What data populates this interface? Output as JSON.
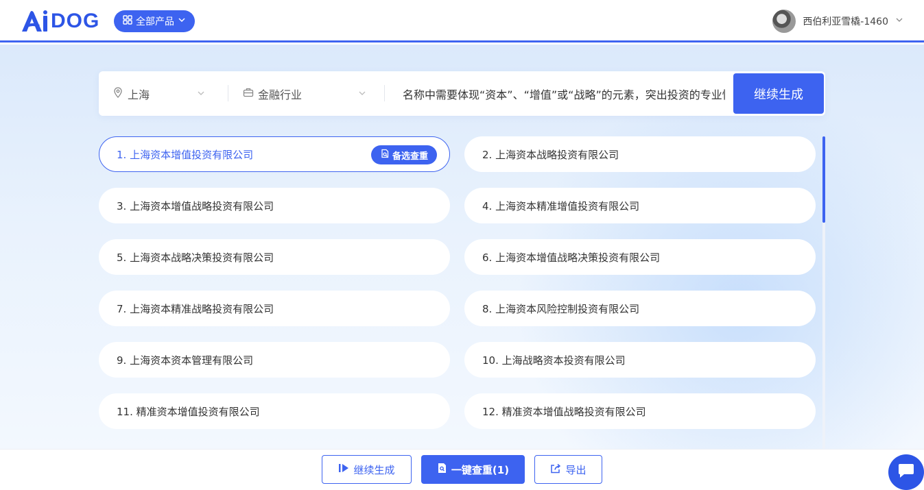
{
  "header": {
    "logo_text": "DOG",
    "products_label": "全部产品",
    "username": "西伯利亚雪橇-1460"
  },
  "search": {
    "city": "上海",
    "industry": "金融行业",
    "prompt": "名称中需要体现“资本”、“增值”或“战略”的元素，突出投资的专业性",
    "generate_label": "继续生成"
  },
  "results": [
    {
      "label": "1. 上海资本增值投资有限公司",
      "selected": true
    },
    {
      "label": "2. 上海资本战略投资有限公司"
    },
    {
      "label": "3. 上海资本增值战略投资有限公司"
    },
    {
      "label": "4. 上海资本精准增值投资有限公司"
    },
    {
      "label": "5. 上海资本战略决策投资有限公司"
    },
    {
      "label": "6. 上海资本增值战略决策投资有限公司"
    },
    {
      "label": "7. 上海资本精准战略投资有限公司"
    },
    {
      "label": "8. 上海资本风险控制投资有限公司"
    },
    {
      "label": "9. 上海资本资本管理有限公司"
    },
    {
      "label": "10. 上海战略资本投资有限公司"
    },
    {
      "label": "11. 精准资本增值投资有限公司"
    },
    {
      "label": "12. 精准资本增值战略投资有限公司"
    }
  ],
  "selected_badge": "备选查重",
  "footer": {
    "continue_label": "继续生成",
    "check_label": "一键查重(1)",
    "export_label": "导出"
  },
  "colors": {
    "accent": "#3d63f0",
    "logo": "#2d55e6"
  }
}
